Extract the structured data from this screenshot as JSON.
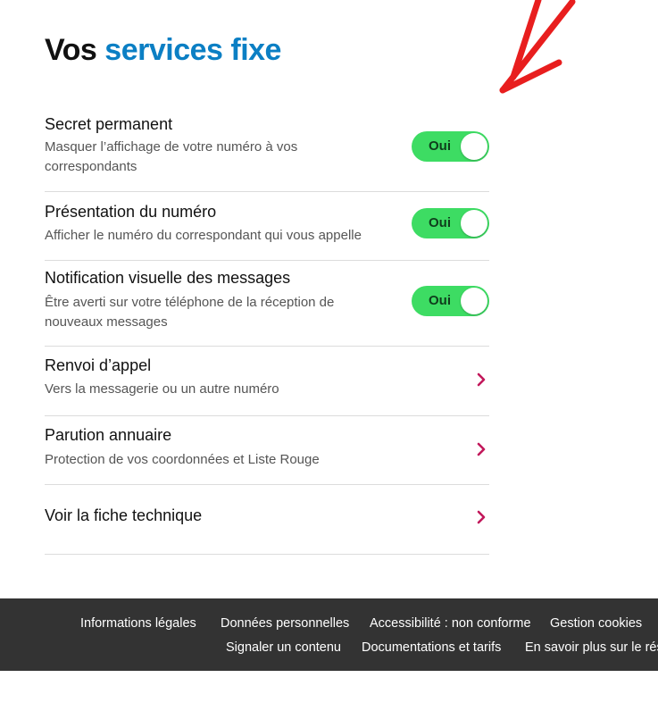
{
  "page": {
    "title_part1": "Vos",
    "title_part2": "services fixe"
  },
  "services": [
    {
      "name": "Secret permanent",
      "description": "Masquer l’affichage de votre numéro à vos correspondants",
      "toggle_label": "Oui",
      "toggle_on": true
    },
    {
      "name": "Présentation du numéro",
      "description": "Afficher le numéro du correspondant qui vous appelle",
      "toggle_label": "Oui",
      "toggle_on": true
    },
    {
      "name": "Notification visuelle des messages",
      "description": "Être averti sur votre téléphone de la réception de nouveaux messages",
      "toggle_label": "Oui",
      "toggle_on": true
    },
    {
      "name": "Renvoi d’appel",
      "description": "Vers la messagerie ou un autre numéro",
      "icon": "chevron-right-icon"
    },
    {
      "name": "Parution annuaire",
      "description": "Protection de vos coordonnées et Liste Rouge",
      "icon": "chevron-right-icon"
    },
    {
      "name": "Voir la fiche technique",
      "icon": "chevron-right-icon"
    }
  ],
  "footer": {
    "links_row1": [
      "Informations légales",
      "Données personnelles",
      "Accessibilité : non conforme",
      "Gestion cookies"
    ],
    "links_row2": [
      "Signaler un contenu",
      "Documentations et tarifs",
      "En savoir plus sur le réseau"
    ]
  },
  "colors": {
    "title_accent": "#0b7fc4",
    "toggle_on": "#3ddc63",
    "chevron": "#c2185b",
    "annotation_arrow": "#e81e1e",
    "footer_bg": "#333333"
  }
}
